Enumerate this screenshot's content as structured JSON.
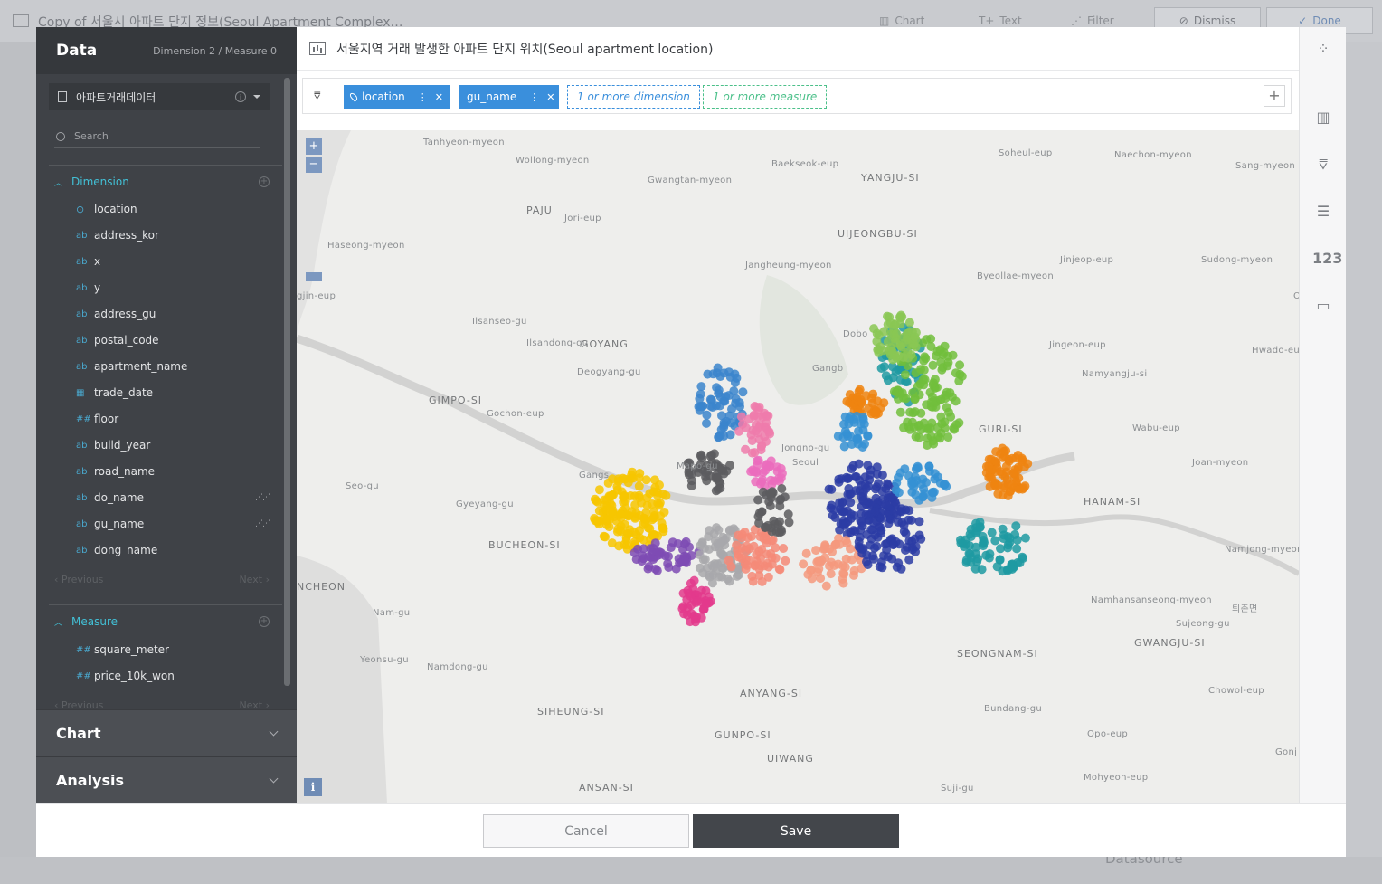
{
  "background": {
    "doc_title": "Copy of 서울시 아파트 단지 정보(Seoul Apartment Complex…",
    "tools": [
      "Chart",
      "Text",
      "Filter"
    ],
    "dismiss_label": "Dismiss",
    "done_label": "Done",
    "datasource_label": "Datasource"
  },
  "left_panel": {
    "title": "Data",
    "subtitle": "Dimension 2 / Measure 0",
    "datasource_name": "아파트거래데이터",
    "search_placeholder": "Search",
    "dimension_label": "Dimension",
    "dimensions": [
      {
        "type": "location",
        "name": "location"
      },
      {
        "type": "ab",
        "name": "address_kor"
      },
      {
        "type": "ab",
        "name": "x"
      },
      {
        "type": "ab",
        "name": "y"
      },
      {
        "type": "ab",
        "name": "address_gu"
      },
      {
        "type": "ab",
        "name": "postal_code"
      },
      {
        "type": "ab",
        "name": "apartment_name"
      },
      {
        "type": "date",
        "name": "trade_date"
      },
      {
        "type": "##",
        "name": "floor"
      },
      {
        "type": "ab",
        "name": "build_year"
      },
      {
        "type": "ab",
        "name": "road_name"
      },
      {
        "type": "ab",
        "name": "do_name"
      },
      {
        "type": "ab",
        "name": "gu_name"
      },
      {
        "type": "ab",
        "name": "dong_name"
      }
    ],
    "pager_prev": "Previous",
    "pager_next": "Next",
    "measure_label": "Measure",
    "measures": [
      {
        "type": "##",
        "name": "square_meter"
      },
      {
        "type": "##",
        "name": "price_10k_won"
      }
    ],
    "chart_label": "Chart",
    "analysis_label": "Analysis"
  },
  "chart_title": "서울지역 거래 발생한 아파트 단지 위치(Seoul apartment location)",
  "shelf": {
    "pills": [
      "location",
      "gu_name"
    ],
    "dimension_placeholder": "1 or more dimension",
    "measure_placeholder": "1 or more measure"
  },
  "map": {
    "zoom_in": "+",
    "zoom_out": "−",
    "info": "i",
    "labels": [
      "Tanhyeon-myeon",
      "Wollong-myeon",
      "Baekseok-eup",
      "YANGJU-SI",
      "Soheul-eup",
      "Naechon-myeon",
      "Sang-myeon",
      "Gwangtan-myeon",
      "PAJU",
      "Jori-eup",
      "UIJEONGBU-SI",
      "Haseong-myeon",
      "Jangheung-myeon",
      "Jinjeop-eup",
      "Sudong-myeon",
      "Byeollae-myeon",
      "gjin-eup",
      "Onam-eup",
      "Ilsanseo-gu",
      "Ilsandong-gu",
      "GOYANG",
      "Jingeon-eup",
      "Hwado-eup",
      "Deogyang-gu",
      "Namyangju-si",
      "GIMPO-SI",
      "Gochon-eup",
      "GURI-SI",
      "Wabu-eup",
      "Seo-gu",
      "Joan-myeon",
      "Gyeyang-gu",
      "HANAM-SI",
      "BUCHEON-SI",
      "Namjong-myeon",
      "NCHEON",
      "Nam-gu",
      "Namhansanseong-myeon",
      "Sujeong-gu",
      "GWANGJU-SI",
      "SEONGNAM-SI",
      "Yeonsu-gu",
      "Namdong-gu",
      "ANYANG-SI",
      "Chowol-eup",
      "SIHEUNG-SI",
      "Bundang-gu",
      "GUNPO-SI",
      "Opo-eup",
      "UIWANG",
      "Mohyeon-eup",
      "ANSAN-SI",
      "Suji-gu",
      "Gonj",
      "퇴촌면",
      "Dobo",
      "Gangb",
      "Jongno-gu",
      "Mapo-gu",
      "Gangs",
      "Seoul"
    ]
  },
  "colors": {
    "accent": "#3a8fdc",
    "measure": "#4cc08a",
    "series": [
      "#f7c600",
      "#7e4bb4",
      "#e33a8c",
      "#a8a8ab",
      "#f48a78",
      "#3b85cc",
      "#ee7bab",
      "#5c5c5f",
      "#2b3ca5",
      "#ef8411",
      "#1e9aa2",
      "#71be3c",
      "#8ac754",
      "#f4997e",
      "#3590d3",
      "#eb6cbd"
    ]
  },
  "right_bar": {
    "number_label": "123"
  },
  "footer": {
    "cancel_label": "Cancel",
    "save_label": "Save"
  }
}
